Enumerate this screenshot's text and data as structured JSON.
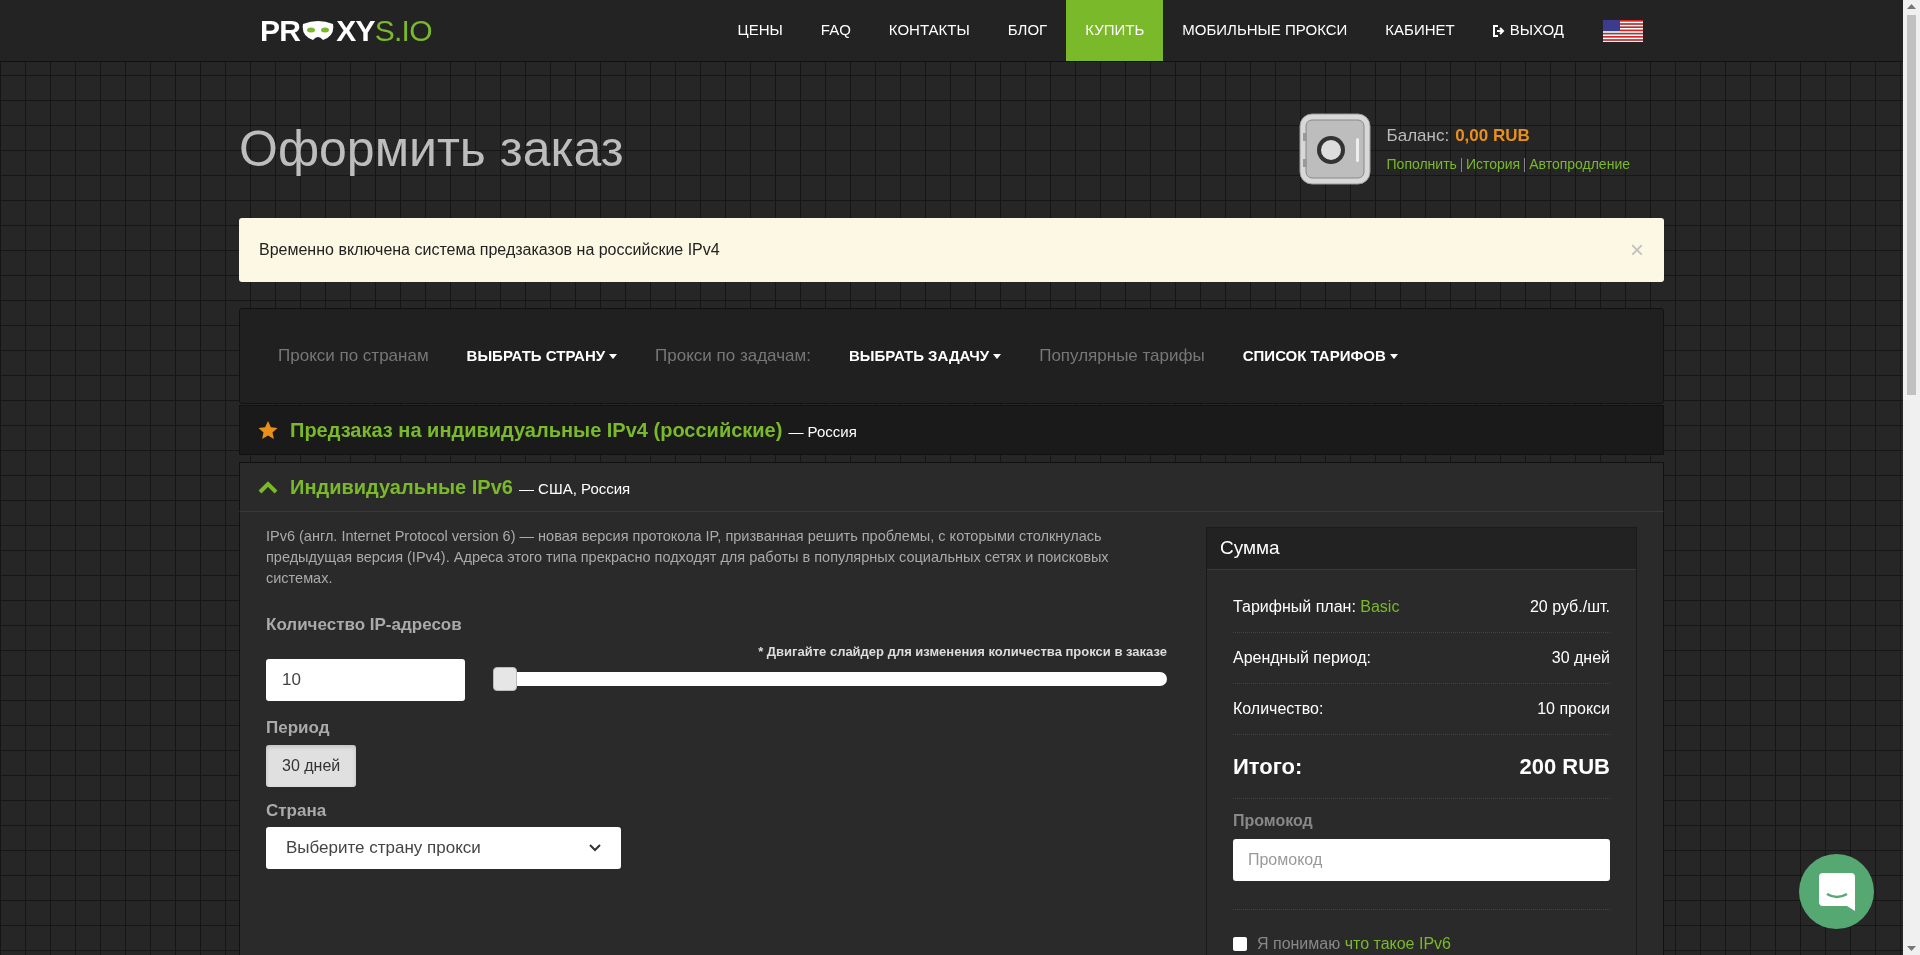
{
  "header": {
    "logo": {
      "left": "PR",
      "middle": "XY",
      "accent": "S.IO"
    },
    "nav": [
      {
        "label": "ЦЕНЫ",
        "selected": false
      },
      {
        "label": "FAQ",
        "selected": false
      },
      {
        "label": "КОНТАКТЫ",
        "selected": false
      },
      {
        "label": "БЛОГ",
        "selected": false
      },
      {
        "label": "КУПИТЬ",
        "selected": true
      },
      {
        "label": "МОБИЛЬНЫЕ ПРОКСИ",
        "selected": false
      },
      {
        "label": "КАБИНЕТ",
        "selected": false
      },
      {
        "label": "ВЫХОД",
        "selected": false,
        "kind": "logout"
      }
    ]
  },
  "page_title": "Оформить заказ",
  "balance": {
    "label": "Баланс:",
    "amount": "0,00 RUB",
    "links": [
      "Пополнить",
      "История",
      "Автопродление"
    ]
  },
  "alert": {
    "text": "Временно включена система предзаказов на российские IPv4",
    "close": "×"
  },
  "filters": [
    {
      "kind": "label",
      "text": "Прокси по странам"
    },
    {
      "kind": "dropdown",
      "text": "ВЫБРАТЬ СТРАНУ"
    },
    {
      "kind": "label",
      "text": "Прокси по задачам:"
    },
    {
      "kind": "dropdown",
      "text": "ВЫБРАТЬ ЗАДАЧУ"
    },
    {
      "kind": "label",
      "text": "Популярные тарифы"
    },
    {
      "kind": "dropdown",
      "text": "СПИСОК ТАРИФОВ"
    }
  ],
  "sections": [
    {
      "title": "Предзаказ на индивидуальные IPv4 (российские)",
      "subtitle": "— Россия",
      "expanded": false,
      "kind": "star"
    },
    {
      "title": "Индивидуальные IPv6",
      "subtitle": "— США, Россия",
      "expanded": true,
      "kind": "chevron"
    }
  ],
  "order": {
    "description": "IPv6 (англ. Internet Protocol version 6) — новая версия протокола IP, призванная решить проблемы, с которыми столкнулась предыдущая версия (IPv4). Адреса этого типа прекрасно подходят для работы в популярных социальных сетях и поисковых системах.",
    "quantity": {
      "label": "Количество IP-адресов",
      "value": "10",
      "hint": "* Двигайте слайдер для изменения количества прокси в заказе",
      "level": 0
    },
    "period": {
      "label": "Период",
      "options": [
        {
          "label": "30 дней",
          "selected": true
        }
      ]
    },
    "country": {
      "label": "Страна",
      "value": "Выберите страну прокси"
    }
  },
  "summary": {
    "title": "Сумма",
    "rows": [
      {
        "label": "Тарифный план:",
        "accent": "Basic",
        "value": "20 руб./шт.",
        "kind": "normal"
      },
      {
        "label": "Арендный период:",
        "value": "30 дней",
        "kind": "normal"
      },
      {
        "label": "Количество:",
        "value": "10 прокси",
        "kind": "normal"
      },
      {
        "label": "Итого:",
        "value": "200 RUB",
        "kind": "total"
      }
    ],
    "promo": {
      "label": "Промокод",
      "placeholder": "Промокод"
    },
    "agree": {
      "text": "Я понимаю",
      "link": "что такое IPv6",
      "checked": false
    }
  }
}
